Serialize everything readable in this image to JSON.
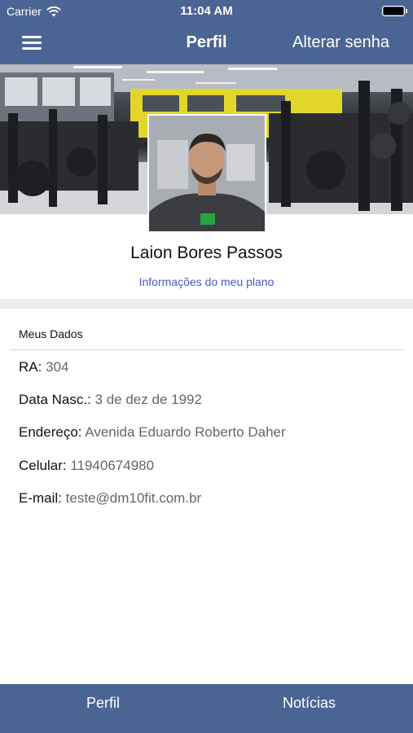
{
  "status": {
    "carrier": "Carrier",
    "time": "11:04 AM"
  },
  "nav": {
    "title": "Perfil",
    "right_action": "Alterar senha"
  },
  "profile": {
    "name": "Laion Bores Passos",
    "plan_link": "Informações do meu plano"
  },
  "my_data": {
    "title": "Meus Dados",
    "rows": [
      {
        "label": "RA:",
        "value": "304"
      },
      {
        "label": "Data Nasc.:",
        "value": "3 de dez de 1992"
      },
      {
        "label": "Endereço:",
        "value": "Avenida Eduardo Roberto Daher"
      },
      {
        "label": "Celular:",
        "value": "11940674980"
      },
      {
        "label": "E-mail:",
        "value": "teste@dm10fit.com.br"
      }
    ]
  },
  "tabs": [
    {
      "label": "Perfil"
    },
    {
      "label": "Notícias"
    }
  ],
  "colors": {
    "bar": "#4a6593",
    "link": "#4a57c9",
    "band": "#ececee"
  }
}
